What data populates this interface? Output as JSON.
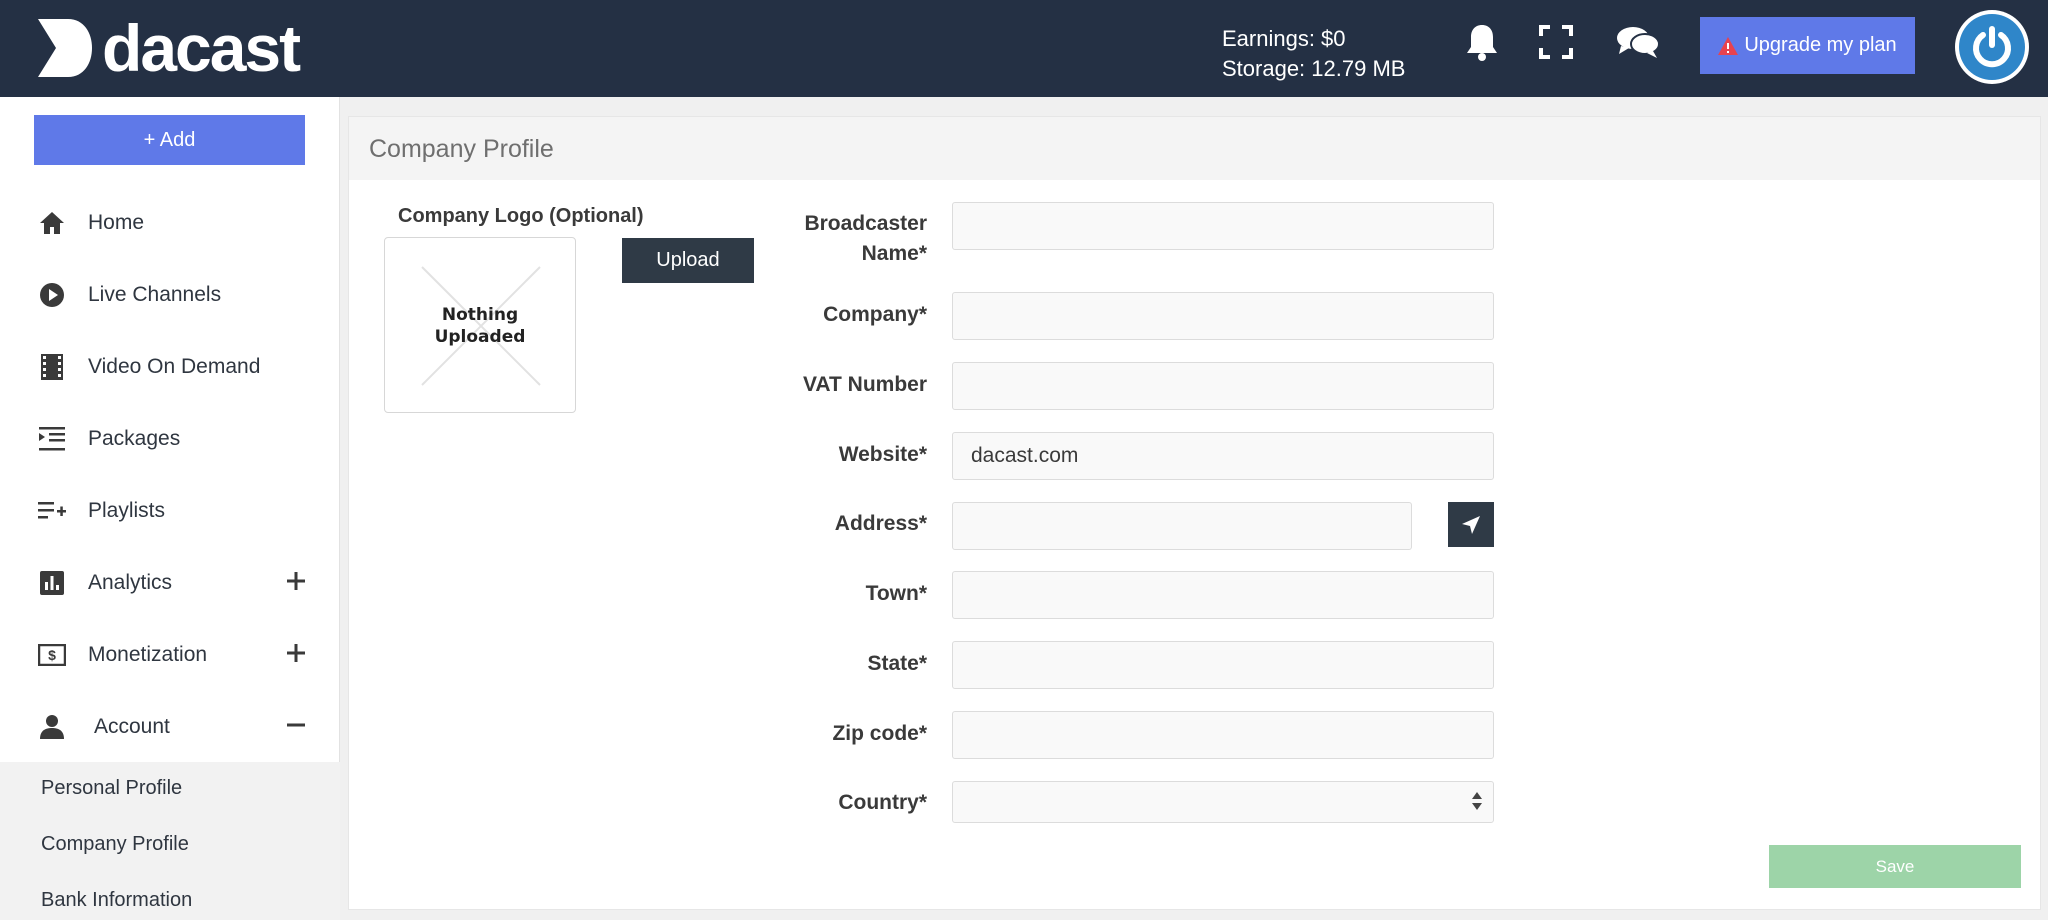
{
  "header": {
    "logo_text": "dacast",
    "earnings": "Earnings: $0",
    "storage": "Storage: 12.79 MB",
    "upgrade_label": "Upgrade my plan",
    "brand_color": "#243044",
    "accent_color": "#5f79e8"
  },
  "sidebar": {
    "add_label": "+ Add",
    "items": [
      {
        "label": "Home",
        "icon": "home-icon"
      },
      {
        "label": "Live Channels",
        "icon": "play-circle-icon"
      },
      {
        "label": "Video On Demand",
        "icon": "film-icon"
      },
      {
        "label": "Packages",
        "icon": "list-indent-icon"
      },
      {
        "label": "Playlists",
        "icon": "playlist-add-icon"
      },
      {
        "label": "Analytics",
        "icon": "bar-chart-icon",
        "toggle": "plus"
      },
      {
        "label": "Monetization",
        "icon": "money-icon",
        "toggle": "plus"
      },
      {
        "label": "Account",
        "icon": "person-icon",
        "toggle": "minus"
      }
    ],
    "account_sub": [
      "Personal Profile",
      "Company Profile",
      "Bank Information"
    ]
  },
  "main": {
    "title": "Company Profile",
    "logo_label": "Company Logo (Optional)",
    "logo_placeholder_line1": "Nothing",
    "logo_placeholder_line2": "Uploaded",
    "upload_label": "Upload",
    "fields": {
      "broadcaster_line1": "Broadcaster",
      "broadcaster_line2": "Name*",
      "broadcaster_value": "",
      "company_label": "Company*",
      "company_value": "",
      "vat_label": "VAT Number",
      "vat_value": "",
      "website_label": "Website*",
      "website_value": "dacast.com",
      "address_label": "Address*",
      "address_value": "",
      "town_label": "Town*",
      "town_value": "",
      "state_label": "State*",
      "state_value": "",
      "zip_label": "Zip code*",
      "zip_value": "",
      "country_label": "Country*",
      "country_value": ""
    },
    "save_label": "Save"
  }
}
